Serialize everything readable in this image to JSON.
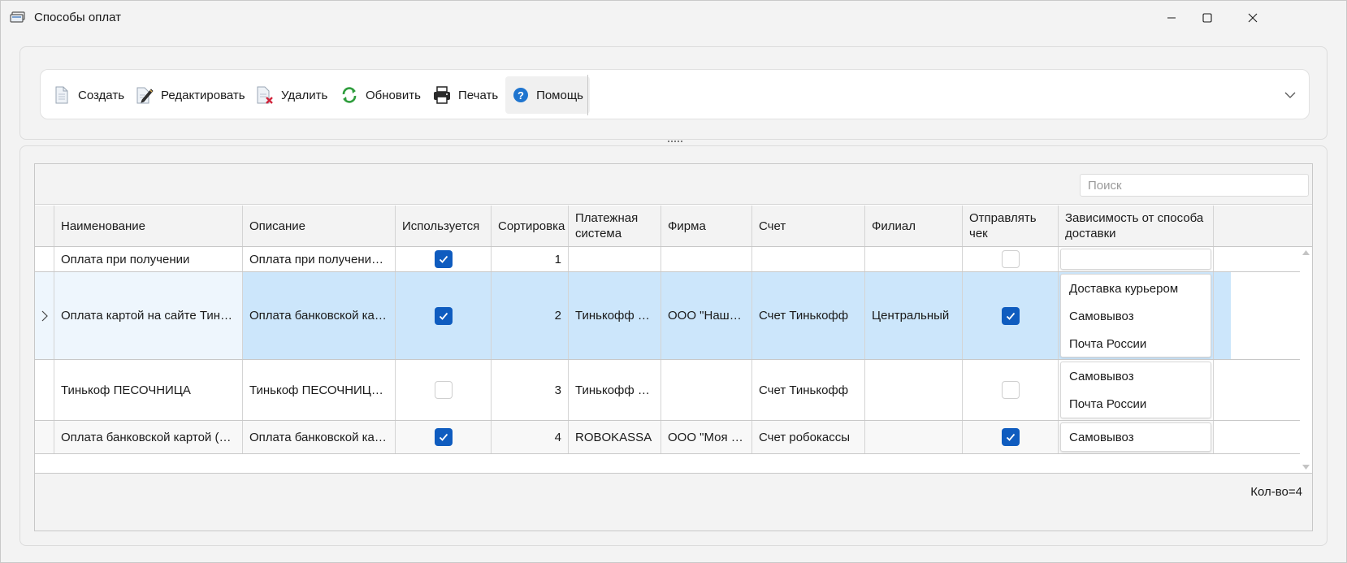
{
  "window": {
    "title": "Способы оплат"
  },
  "toolbar": {
    "buttons": [
      {
        "id": "create",
        "label": "Создать",
        "icon": "new-document-icon"
      },
      {
        "id": "edit",
        "label": "Редактировать",
        "icon": "edit-document-icon"
      },
      {
        "id": "delete",
        "label": "Удалить",
        "icon": "delete-document-icon"
      },
      {
        "id": "refresh",
        "label": "Обновить",
        "icon": "refresh-icon"
      },
      {
        "id": "print",
        "label": "Печать",
        "icon": "printer-icon"
      },
      {
        "id": "help",
        "label": "Помощь",
        "icon": "help-icon"
      }
    ]
  },
  "search": {
    "placeholder": "Поиск"
  },
  "grid": {
    "columns": [
      "Наименование",
      "Описание",
      "Используется",
      "Сортировка",
      "Платежная система",
      "Фирма",
      "Счет",
      "Филиал",
      "Отправлять чек",
      "Зависимость от способа доставки"
    ],
    "rows": [
      {
        "name": "Оплата при получении",
        "description": "Оплата при получении,...",
        "used": true,
        "sort": "1",
        "payment_system": "",
        "firm": "",
        "account": "",
        "branch": "",
        "send_receipt": false,
        "delivery": []
      },
      {
        "name": "Оплата картой на сайте Тинькоф",
        "description": "Оплата банковской карт...",
        "used": true,
        "sort": "2",
        "payment_system": "Тинькофф Ба...",
        "firm": "ООО \"Наша к...",
        "account": "Счет Тинькофф",
        "branch": "Центральный",
        "send_receipt": true,
        "delivery": [
          "Доставка курьером",
          "Самовывоз",
          "Почта России"
        ]
      },
      {
        "name": "Тинькоф ПЕСОЧНИЦА",
        "description": "Тинькоф ПЕСОЧНИЦА (н...",
        "used": false,
        "sort": "3",
        "payment_system": "Тинькофф Ба...",
        "firm": "",
        "account": "Счет Тинькофф",
        "branch": "",
        "send_receipt": false,
        "delivery": [
          "Самовывоз",
          "Почта России"
        ]
      },
      {
        "name": "Оплата банковской картой (Ro...",
        "description": "Оплата банковской карт...",
        "used": true,
        "sort": "4",
        "payment_system": "ROBOKASSA",
        "firm": "ООО \"Моя к...",
        "account": "Счет робокассы",
        "branch": "",
        "send_receipt": true,
        "delivery": [
          "Самовывоз"
        ]
      }
    ],
    "selected_row": 1
  },
  "footer": {
    "count": "Кол-во=4"
  },
  "colors": {
    "accent": "#0f5cbf",
    "selection": "#cce6fb"
  }
}
